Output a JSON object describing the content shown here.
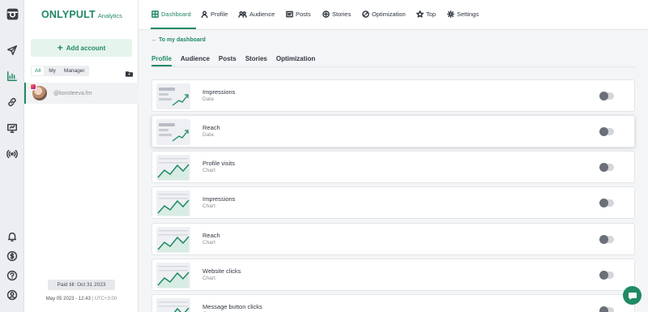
{
  "brand": {
    "name": "ONLYPULT",
    "sub": "Analytics"
  },
  "sidebar": {
    "add_account": "Add account",
    "filters": [
      "All",
      "My",
      "Manager"
    ],
    "account": "@koroteeva.fm",
    "paid_till": "Paid till: Oct 31 2023",
    "datetime": "May 05 2023 - 12:43",
    "timezone": "UTC+3:00"
  },
  "rail_icons": [
    "instagram-icon",
    "send-icon",
    "analytics-icon",
    "link-icon",
    "monitor-icon",
    "broadcast-icon",
    "bell-icon",
    "dollar-icon",
    "help-icon",
    "user-icon"
  ],
  "nav": [
    "Dashboard",
    "Profile",
    "Audience",
    "Posts",
    "Stories",
    "Optimization",
    "Top",
    "Settings"
  ],
  "back_link": "To my dashboard",
  "subtabs": [
    "Profile",
    "Audience",
    "Posts",
    "Stories",
    "Optimization"
  ],
  "widgets": [
    {
      "title": "Impressions",
      "type": "Data",
      "enabled": false
    },
    {
      "title": "Reach",
      "type": "Data",
      "enabled": false
    },
    {
      "title": "Profile visits",
      "type": "Chart",
      "enabled": false
    },
    {
      "title": "Impressions",
      "type": "Chart",
      "enabled": false
    },
    {
      "title": "Reach",
      "type": "Chart",
      "enabled": false
    },
    {
      "title": "Website clicks",
      "type": "Chart",
      "enabled": false
    },
    {
      "title": "Message button clicks",
      "type": "Chart",
      "enabled": false
    }
  ],
  "colors": {
    "accent": "#1f8a64",
    "accent_light": "#e6f4ee"
  }
}
